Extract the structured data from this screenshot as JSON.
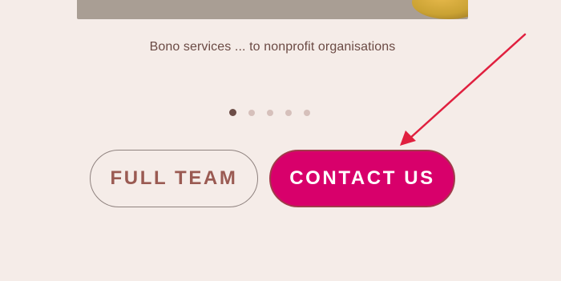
{
  "carousel": {
    "caption": "Bono services ... to nonprofit organisations",
    "dots": [
      {
        "active": true
      },
      {
        "active": false
      },
      {
        "active": false
      },
      {
        "active": false
      },
      {
        "active": false
      }
    ]
  },
  "buttons": {
    "full_team_label": "FULL TEAM",
    "contact_label": "CONTACT US"
  },
  "colors": {
    "background": "#f5ece8",
    "accent": "#d8006b",
    "annotation_arrow": "#e0203f"
  },
  "icons": {
    "annotation": "arrow-icon"
  }
}
